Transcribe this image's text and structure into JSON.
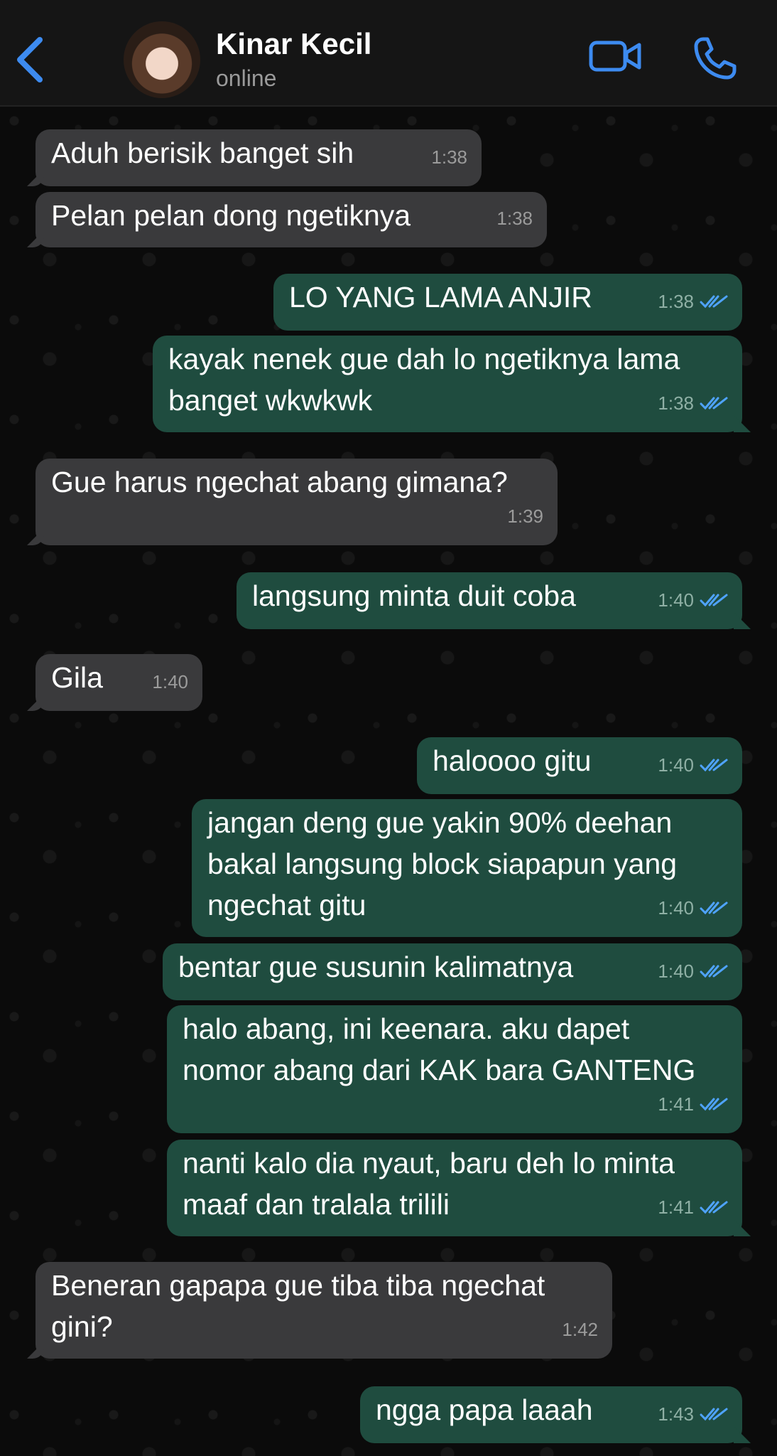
{
  "header": {
    "contact_name": "Kinar Kecil",
    "status": "online"
  },
  "messages": [
    {
      "direction": "in",
      "text": "Aduh berisik banget sih",
      "time": "1:38"
    },
    {
      "direction": "in",
      "text": "Pelan pelan dong ngetiknya",
      "time": "1:38"
    },
    {
      "direction": "out",
      "text": "LO YANG LAMA ANJIR",
      "time": "1:38"
    },
    {
      "direction": "out",
      "text": "kayak nenek gue dah lo ngetiknya lama\nbanget wkwkwk",
      "time": "1:38"
    },
    {
      "direction": "in",
      "text": "Gue harus ngechat abang gimana?",
      "time": "1:39"
    },
    {
      "direction": "out",
      "text": "langsung minta duit coba",
      "time": "1:40"
    },
    {
      "direction": "in",
      "text": "Gila",
      "time": "1:40"
    },
    {
      "direction": "out",
      "text": "haloooo gitu",
      "time": "1:40"
    },
    {
      "direction": "out",
      "text": "jangan deng gue yakin 90% deehan\nbakal langsung block siapapun yang\nngechat gitu",
      "time": "1:40"
    },
    {
      "direction": "out",
      "text": "bentar gue susunin kalimatnya",
      "time": "1:40"
    },
    {
      "direction": "out",
      "text": "halo abang, ini keenara. aku dapet\nnomor abang dari KAK bara GANTENG",
      "time": "1:41"
    },
    {
      "direction": "out",
      "text": "nanti kalo dia nyaut, baru deh lo minta\nmaaf dan tralala trilili",
      "time": "1:41"
    },
    {
      "direction": "in",
      "text": "Beneran gapapa gue tiba tiba ngechat\ngini?",
      "time": "1:42"
    },
    {
      "direction": "out",
      "text": "ngga papa laaah",
      "time": "1:43"
    }
  ],
  "colors": {
    "accent": "#3d8bf0",
    "incoming_bubble": "#3a3a3c",
    "outgoing_bubble": "#1f4c3f",
    "read_ticks": "#4fa3ff"
  }
}
